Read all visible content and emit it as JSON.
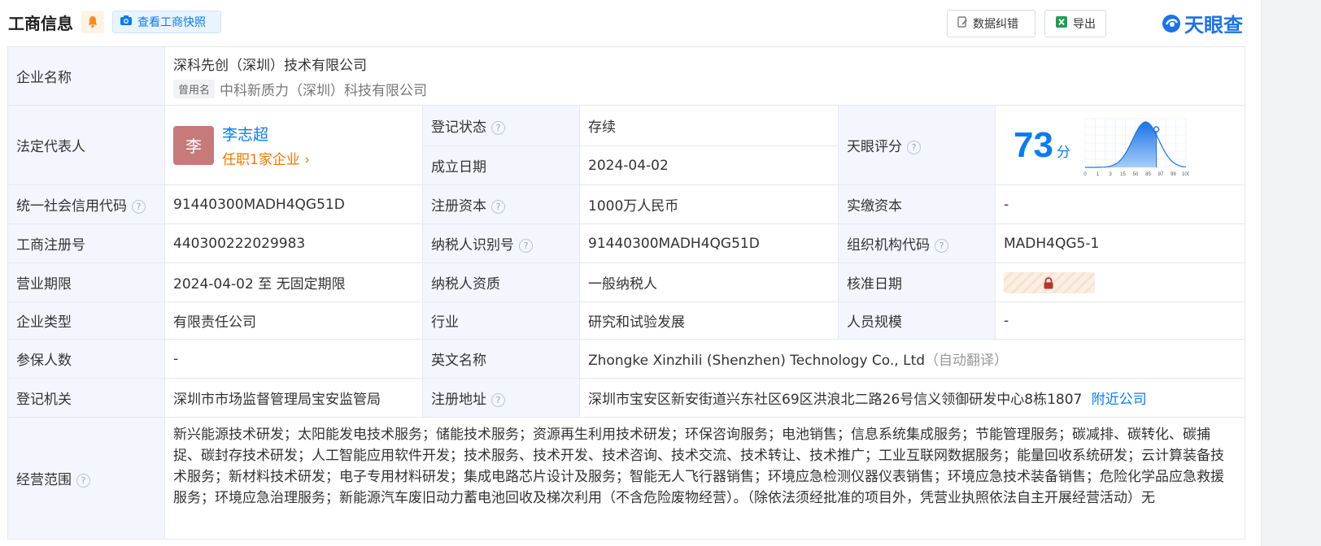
{
  "header": {
    "title": "工商信息",
    "snapshot_label": "查看工商快照",
    "correct_label": "数据纠错",
    "export_label": "导出",
    "logo_text": "天眼查"
  },
  "colors": {
    "accent": "#0a7cf0",
    "label_bg": "#f3f7fd",
    "status_green": "#1aa048",
    "orange": "#f07800"
  },
  "labels": {
    "company_name": "企业名称",
    "legal_rep": "法定代表人",
    "reg_status": "登记状态",
    "est_date": "成立日期",
    "score": "天眼评分",
    "credit_code": "统一社会信用代码",
    "reg_capital": "注册资本",
    "paid_capital": "实缴资本",
    "biz_reg_no": "工商注册号",
    "taxpayer_id": "纳税人识别号",
    "org_code": "组织机构代码",
    "biz_term": "营业期限",
    "taxpayer_qual": "纳税人资质",
    "approval_date": "核准日期",
    "company_type": "企业类型",
    "industry": "行业",
    "staff_size": "人员规模",
    "insured": "参保人数",
    "english_name": "英文名称",
    "reg_authority": "登记机关",
    "reg_address": "注册地址",
    "biz_scope": "经营范围"
  },
  "values": {
    "company_name": "深科先创（深圳）技术有限公司",
    "former_tag": "曾用名",
    "former_name": "中科新质力（深圳）科技有限公司",
    "avatar_char": "李",
    "legal_rep_name": "李志超",
    "legal_rep_positions": "任职1家企业 ›",
    "reg_status": "存续",
    "est_date": "2024-04-02",
    "score": "73",
    "score_unit": "分",
    "credit_code": "91440300MADH4QG51D",
    "reg_capital": "1000万人民币",
    "paid_capital": "-",
    "biz_reg_no": "440300222029983",
    "taxpayer_id": "91440300MADH4QG51D",
    "org_code": "MADH4QG5-1",
    "biz_term": "2024-04-02 至 无固定期限",
    "taxpayer_qual": "一般纳税人",
    "company_type": "有限责任公司",
    "industry": "研究和试验发展",
    "staff_size": "-",
    "insured": "-",
    "english_name": "Zhongke Xinzhili (Shenzhen) Technology Co., Ltd",
    "english_note": "（自动翻译）",
    "reg_authority": "深圳市市场监督管理局宝安监管局",
    "reg_address": "深圳市宝安区新安街道兴东社区69区洪浪北二路26号信义领御研发中心8栋1807",
    "nearby_link": "附近公司",
    "biz_scope": "新兴能源技术研发；太阳能发电技术服务；储能技术服务；资源再生利用技术研发；环保咨询服务；电池销售；信息系统集成服务；节能管理服务；碳减排、碳转化、碳捕捉、碳封存技术研发；人工智能应用软件开发；技术服务、技术开发、技术咨询、技术交流、技术转让、技术推广；工业互联网数据服务；能量回收系统研发；云计算装备技术服务；新材料技术研发；电子专用材料研发；集成电路芯片设计及服务；智能无人飞行器销售；环境应急检测仪器仪表销售；环境应急技术装备销售；危险化学品应急救援服务；环境应急治理服务；新能源汽车废旧动力蓄电池回收及梯次利用（不含危险废物经营）。（除依法须经批准的项目外，凭营业执照依法自主开展经营活动）无"
  },
  "score_chart": {
    "tick_labels": [
      "0",
      "1",
      "3",
      "15",
      "50",
      "85",
      "97",
      "99",
      "100"
    ],
    "marker_value": 73
  }
}
